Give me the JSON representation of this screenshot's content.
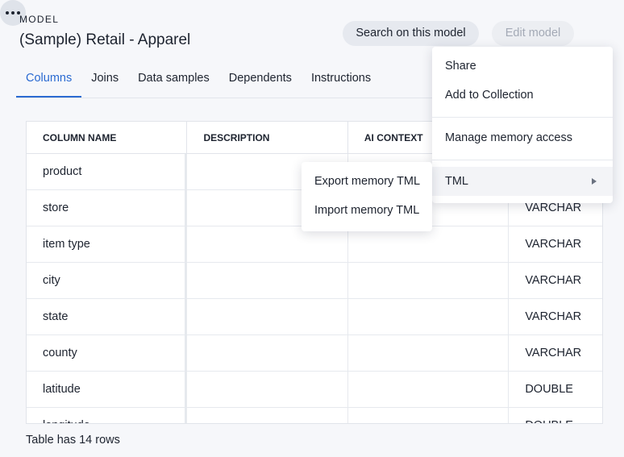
{
  "header": {
    "eyebrow": "MODEL",
    "title": "(Sample) Retail - Apparel",
    "search_label": "Search on this model",
    "edit_label": "Edit model",
    "more_icon": "more-horizontal-icon"
  },
  "tabs": [
    {
      "label": "Columns",
      "active": true
    },
    {
      "label": "Joins"
    },
    {
      "label": "Data samples"
    },
    {
      "label": "Dependents"
    },
    {
      "label": "Instructions"
    }
  ],
  "table": {
    "headers": [
      "COLUMN NAME",
      "DESCRIPTION",
      "AI CONTEXT",
      ""
    ],
    "rows": [
      [
        "product",
        "",
        "",
        ""
      ],
      [
        "store",
        "",
        "",
        "VARCHAR"
      ],
      [
        "item type",
        "",
        "",
        "VARCHAR"
      ],
      [
        "city",
        "",
        "",
        "VARCHAR"
      ],
      [
        "state",
        "",
        "",
        "VARCHAR"
      ],
      [
        "county",
        "",
        "",
        "VARCHAR"
      ],
      [
        "latitude",
        "",
        "",
        "DOUBLE"
      ],
      [
        "longitude",
        "",
        "",
        "DOUBLE"
      ]
    ]
  },
  "footer": {
    "rows_note": "Table has 14 rows"
  },
  "menu": {
    "items": [
      "Share",
      "Add to Collection",
      "Manage memory access",
      "TML"
    ],
    "submenu": [
      "Export memory TML",
      "Import memory TML"
    ]
  }
}
